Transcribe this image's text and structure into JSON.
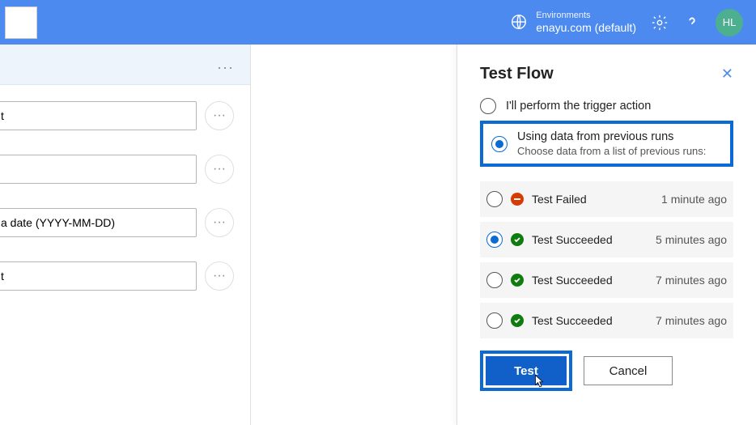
{
  "header": {
    "env_label": "Environments",
    "env_value": "enayu.com (default)",
    "avatar": "HL"
  },
  "left": {
    "placeholder_t": "t",
    "placeholder_date": "a date (YYYY-MM-DD)"
  },
  "panel": {
    "title": "Test Flow",
    "opt_manual": "I'll perform the trigger action",
    "opt_previous": "Using data from previous runs",
    "opt_previous_sub": "Choose data from a list of previous runs:",
    "runs": [
      {
        "status": "fail",
        "label": "Test Failed",
        "time": "1 minute ago",
        "selected": false
      },
      {
        "status": "succ",
        "label": "Test Succeeded",
        "time": "5 minutes ago",
        "selected": true
      },
      {
        "status": "succ",
        "label": "Test Succeeded",
        "time": "7 minutes ago",
        "selected": false
      },
      {
        "status": "succ",
        "label": "Test Succeeded",
        "time": "7 minutes ago",
        "selected": false
      }
    ],
    "btn_test": "Test",
    "btn_cancel": "Cancel"
  }
}
